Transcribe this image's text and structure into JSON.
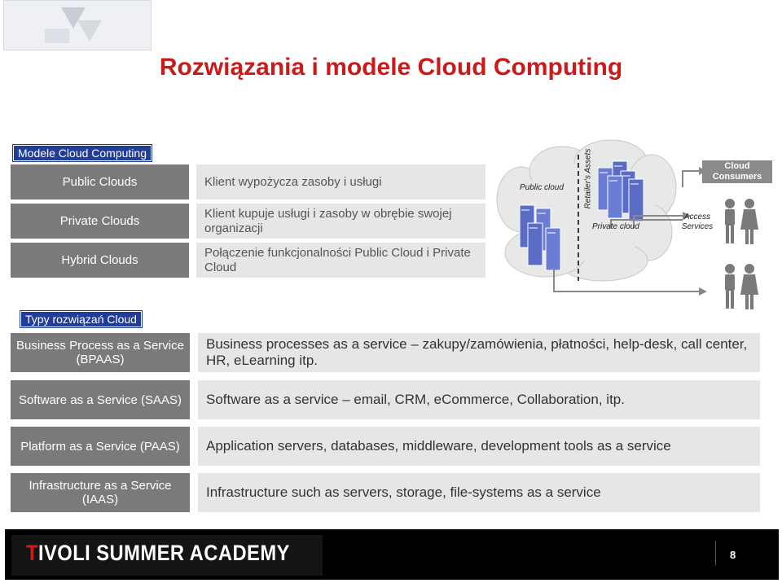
{
  "title": "Rozwiązania i modele Cloud Computing",
  "models_section": {
    "label": "Modele Cloud Computing",
    "rows": [
      {
        "name": "Public Clouds",
        "desc": "Klient wypożycza zasoby i usługi"
      },
      {
        "name": "Private Clouds",
        "desc": "Klient kupuje usługi i zasoby w obrębie swojej organizacji"
      },
      {
        "name": "Hybrid Clouds",
        "desc": "Połączenie funkcjonalności Public Cloud i Private Cloud"
      }
    ]
  },
  "diagram": {
    "public_cloud": "Public cloud",
    "retailers_assets": "Retailer's Assets",
    "private_cloud": "Private cloud",
    "access_services": "Access Services",
    "cloud_consumers": "Cloud Consumers"
  },
  "types_section": {
    "label": "Typy rozwiązań Cloud",
    "rows": [
      {
        "name": "Business Process as a Service (BPAAS)",
        "desc": "Business processes as a service – zakupy/zamówienia, płatności, help-desk, call center, HR, eLearning itp."
      },
      {
        "name": "Software as a Service (SAAS)",
        "desc": "Software as a service – email, CRM, eCommerce, Collaboration, itp."
      },
      {
        "name": "Platform as a Service (PAAS)",
        "desc": "Application servers, databases, middleware, development tools as a service"
      },
      {
        "name": "Infrastructure as a Service (IAAS)",
        "desc": "Infrastructure such as servers, storage, file-systems as a service"
      }
    ]
  },
  "footer": {
    "brand_prefix": "T",
    "brand": "IVOLI SUMMER ACADEMY",
    "page_number": "8"
  }
}
